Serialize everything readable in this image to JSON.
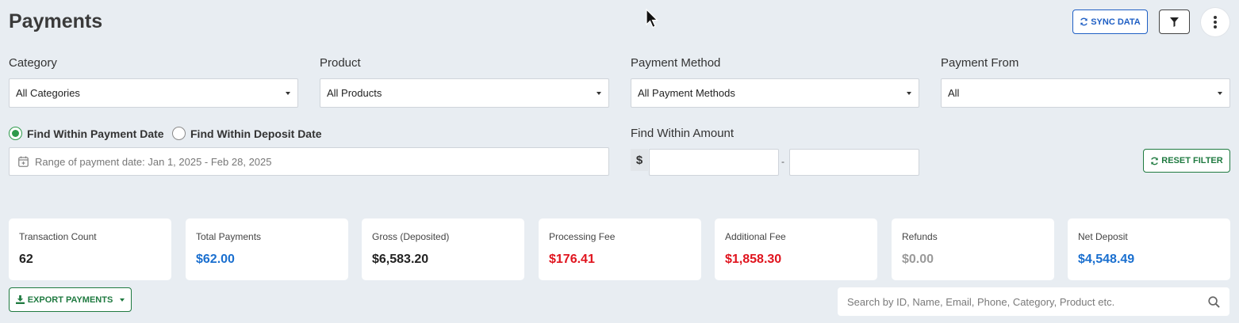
{
  "header": {
    "title": "Payments",
    "sync_label": "SYNC DATA",
    "brand_color": "#1f5fc4"
  },
  "filters": {
    "category": {
      "label": "Category",
      "value": "All Categories"
    },
    "product": {
      "label": "Product",
      "value": "All Products"
    },
    "payment_method": {
      "label": "Payment Method",
      "value": "All Payment Methods"
    },
    "payment_from": {
      "label": "Payment From",
      "value": "All"
    },
    "date_mode": {
      "option_payment": "Find Within Payment Date",
      "option_deposit": "Find Within Deposit Date",
      "selected": "payment"
    },
    "date_range_text": "Range of payment date: Jan 1, 2025 - Feb 28, 2025",
    "amount": {
      "label": "Find Within Amount",
      "currency": "$",
      "separator": "-",
      "min": "",
      "max": ""
    },
    "reset_label": "RESET FILTER"
  },
  "stats": [
    {
      "label": "Transaction Count",
      "value": "62",
      "color": "#222222"
    },
    {
      "label": "Total Payments",
      "value": "$62.00",
      "color": "#1a6fcf"
    },
    {
      "label": "Gross (Deposited)",
      "value": "$6,583.20",
      "color": "#222222"
    },
    {
      "label": "Processing Fee",
      "value": "$176.41",
      "color": "#e0141e"
    },
    {
      "label": "Additional Fee",
      "value": "$1,858.30",
      "color": "#e0141e"
    },
    {
      "label": "Refunds",
      "value": "$0.00",
      "color": "#9a9a9a"
    },
    {
      "label": "Net Deposit",
      "value": "$4,548.49",
      "color": "#1a6fcf"
    }
  ],
  "export_label": "EXPORT PAYMENTS",
  "search": {
    "placeholder": "Search by ID, Name, Email, Phone, Category, Product etc.",
    "value": ""
  }
}
